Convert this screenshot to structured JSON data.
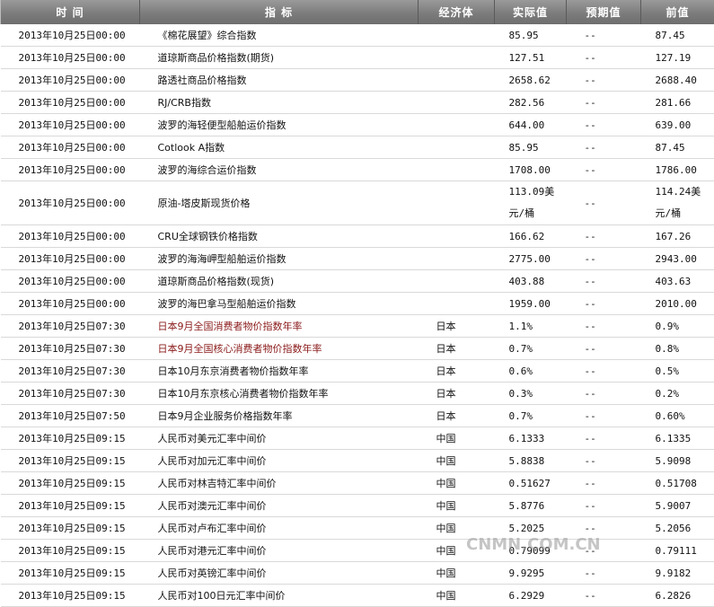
{
  "header": {
    "time": "时  间",
    "indicator": "指  标",
    "economy": "经济体",
    "actual": "实际值",
    "expected": "预期值",
    "previous": "前值"
  },
  "rows": [
    {
      "time": "2013年10月25日00:00",
      "indicator": "《棉花展望》综合指数",
      "economy": "",
      "actual": "85.95",
      "expected": "--",
      "previous": "87.45"
    },
    {
      "time": "2013年10月25日00:00",
      "indicator": "道琼斯商品价格指数(期货)",
      "economy": "",
      "actual": "127.51",
      "expected": "--",
      "previous": "127.19"
    },
    {
      "time": "2013年10月25日00:00",
      "indicator": "路透社商品价格指数",
      "economy": "",
      "actual": "2658.62",
      "expected": "--",
      "previous": "2688.40"
    },
    {
      "time": "2013年10月25日00:00",
      "indicator": "RJ/CRB指数",
      "economy": "",
      "actual": "282.56",
      "expected": "--",
      "previous": "281.66"
    },
    {
      "time": "2013年10月25日00:00",
      "indicator": "波罗的海轻便型船舶运价指数",
      "economy": "",
      "actual": "644.00",
      "expected": "--",
      "previous": "639.00"
    },
    {
      "time": "2013年10月25日00:00",
      "indicator": "Cotlook A指数",
      "economy": "",
      "actual": "85.95",
      "expected": "--",
      "previous": "87.45"
    },
    {
      "time": "2013年10月25日00:00",
      "indicator": "波罗的海综合运价指数",
      "economy": "",
      "actual": "1708.00",
      "expected": "--",
      "previous": "1786.00"
    },
    {
      "time": "2013年10月25日00:00",
      "indicator": "原油-塔皮斯现货价格",
      "economy": "",
      "actual": "113.09美元/桶",
      "expected": "--",
      "previous": "114.24美元/桶"
    },
    {
      "time": "2013年10月25日00:00",
      "indicator": "CRU全球钢铁价格指数",
      "economy": "",
      "actual": "166.62",
      "expected": "--",
      "previous": "167.26"
    },
    {
      "time": "2013年10月25日00:00",
      "indicator": "波罗的海海岬型船舶运价指数",
      "economy": "",
      "actual": "2775.00",
      "expected": "--",
      "previous": "2943.00"
    },
    {
      "time": "2013年10月25日00:00",
      "indicator": "道琼斯商品价格指数(现货)",
      "economy": "",
      "actual": "403.88",
      "expected": "--",
      "previous": "403.63"
    },
    {
      "time": "2013年10月25日00:00",
      "indicator": "波罗的海巴拿马型船舶运价指数",
      "economy": "",
      "actual": "1959.00",
      "expected": "--",
      "previous": "2010.00"
    },
    {
      "time": "2013年10月25日07:30",
      "indicator": "日本9月全国消费者物价指数年率",
      "economy": "日本",
      "actual": "1.1%",
      "expected": "--",
      "previous": "0.9%"
    },
    {
      "time": "2013年10月25日07:30",
      "indicator": "日本9月全国核心消费者物价指数年率",
      "economy": "日本",
      "actual": "0.7%",
      "expected": "--",
      "previous": "0.8%"
    },
    {
      "time": "2013年10月25日07:30",
      "indicator": "日本10月东京消费者物价指数年率",
      "economy": "日本",
      "actual": "0.6%",
      "expected": "--",
      "previous": "0.5%"
    },
    {
      "time": "2013年10月25日07:30",
      "indicator": "日本10月东京核心消费者物价指数年率",
      "economy": "日本",
      "actual": "0.3%",
      "expected": "--",
      "previous": "0.2%"
    },
    {
      "time": "2013年10月25日07:50",
      "indicator": "日本9月企业服务价格指数年率",
      "economy": "日本",
      "actual": "0.7%",
      "expected": "--",
      "previous": "0.60%"
    },
    {
      "time": "2013年10月25日09:15",
      "indicator": "人民币对美元汇率中间价",
      "economy": "中国",
      "actual": "6.1333",
      "expected": "--",
      "previous": "6.1335"
    },
    {
      "time": "2013年10月25日09:15",
      "indicator": "人民币对加元汇率中间价",
      "economy": "中国",
      "actual": "5.8838",
      "expected": "--",
      "previous": "5.9098"
    },
    {
      "time": "2013年10月25日09:15",
      "indicator": "人民币对林吉特汇率中间价",
      "economy": "中国",
      "actual": "0.51627",
      "expected": "--",
      "previous": "0.51708"
    },
    {
      "time": "2013年10月25日09:15",
      "indicator": "人民币对澳元汇率中间价",
      "economy": "中国",
      "actual": "5.8776",
      "expected": "--",
      "previous": "5.9007"
    },
    {
      "time": "2013年10月25日09:15",
      "indicator": "人民币对卢布汇率中间价",
      "economy": "中国",
      "actual": "5.2025",
      "expected": "--",
      "previous": "5.2056"
    },
    {
      "time": "2013年10月25日09:15",
      "indicator": "人民币对港元汇率中间价",
      "economy": "中国",
      "actual": "0.79099",
      "expected": "--",
      "previous": "0.79111"
    },
    {
      "time": "2013年10月25日09:15",
      "indicator": "人民币对英镑汇率中间价",
      "economy": "中国",
      "actual": "9.9295",
      "expected": "--",
      "previous": "9.9182"
    },
    {
      "time": "2013年10月25日09:15",
      "indicator": "人民币对100日元汇率中间价",
      "economy": "中国",
      "actual": "6.2929",
      "expected": "--",
      "previous": "6.2826"
    }
  ],
  "highlight_color": "#8b1a1a",
  "watermark": "CNMN.COM.CN"
}
